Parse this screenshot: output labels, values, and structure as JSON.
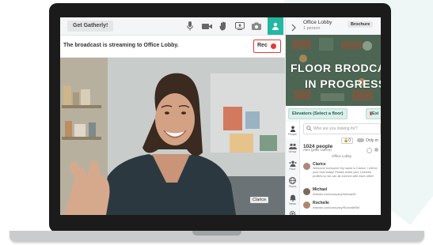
{
  "colors": {
    "accent": "#22b8a3",
    "record": "#e53935"
  },
  "toolbar": {
    "get_button": "Get Gatherly!",
    "icons": [
      "mic-icon",
      "video-camera-icon",
      "hand-raise-icon",
      "screen-share-icon",
      "camera-icon",
      "person-icon"
    ]
  },
  "broadcast": {
    "message": "The broadcast is streaming to Office Lobby.",
    "rec_label": "Rec"
  },
  "video": {
    "participant_name": "Clarice"
  },
  "room": {
    "title": "Office Lobby",
    "subtitle": "1 person",
    "brochure_label": "Brochure"
  },
  "floor": {
    "line1": "FLOOR BRODCA",
    "line2": "IN PROGRESS"
  },
  "elevators_label": "Elevators (Select a floor)",
  "exit_label": "Exi",
  "nav": [
    {
      "label": "People",
      "icon": "person-icon"
    },
    {
      "label": "Group",
      "icon": "group-icon"
    },
    {
      "label": "Floor",
      "icon": "floor-icon"
    },
    {
      "label": "Floors",
      "icon": "globe-icon"
    },
    {
      "label": "News",
      "icon": "bell-icon"
    },
    {
      "label": "",
      "icon": "gear-icon"
    }
  ],
  "people": {
    "search_placeholder": "Who are you looking for?",
    "count_label": "1024 people",
    "badge": "0",
    "toggle_label": "Only m",
    "member_line": "Alex (jean clarice)",
    "location": "Office Lobby"
  },
  "messages": [
    {
      "name": "Clarice",
      "text": "Welcome everyone! My name is Clarice. I will be your host today! Please share your LinkedIn profiles so we can all connect with each other!"
    },
    {
      "name": "Michael",
      "text": "linkedin.com/company/MichaelG"
    },
    {
      "name": "Rochelle",
      "text": "linkedin.com/company/RochelleBM"
    }
  ]
}
